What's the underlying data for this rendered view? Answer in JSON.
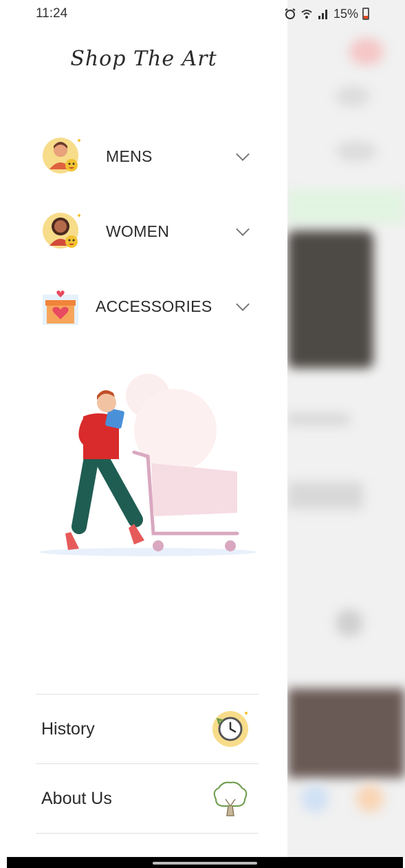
{
  "status_bar": {
    "time": "11:24",
    "battery": "15%",
    "icons": [
      "alarm-icon",
      "wifi-icon",
      "signal-icon",
      "battery-icon"
    ]
  },
  "drawer": {
    "brand": "Shop The Art",
    "categories": [
      {
        "label": "MENS",
        "icon": "man-avatar-icon"
      },
      {
        "label": "WOMEN",
        "icon": "woman-avatar-icon"
      },
      {
        "label": "ACCESSORIES",
        "icon": "gift-box-icon"
      }
    ],
    "illustration": "shopper-with-cart-illustration",
    "menu": [
      {
        "label": "History",
        "icon": "history-clock-icon"
      },
      {
        "label": "About Us",
        "icon": "tree-icon"
      }
    ]
  },
  "colors": {
    "accent_yellow": "#f7dc8a",
    "shirt_red": "#d92b2b",
    "pants_green": "#1f5d52",
    "cart_pink": "#d9a8c0"
  }
}
